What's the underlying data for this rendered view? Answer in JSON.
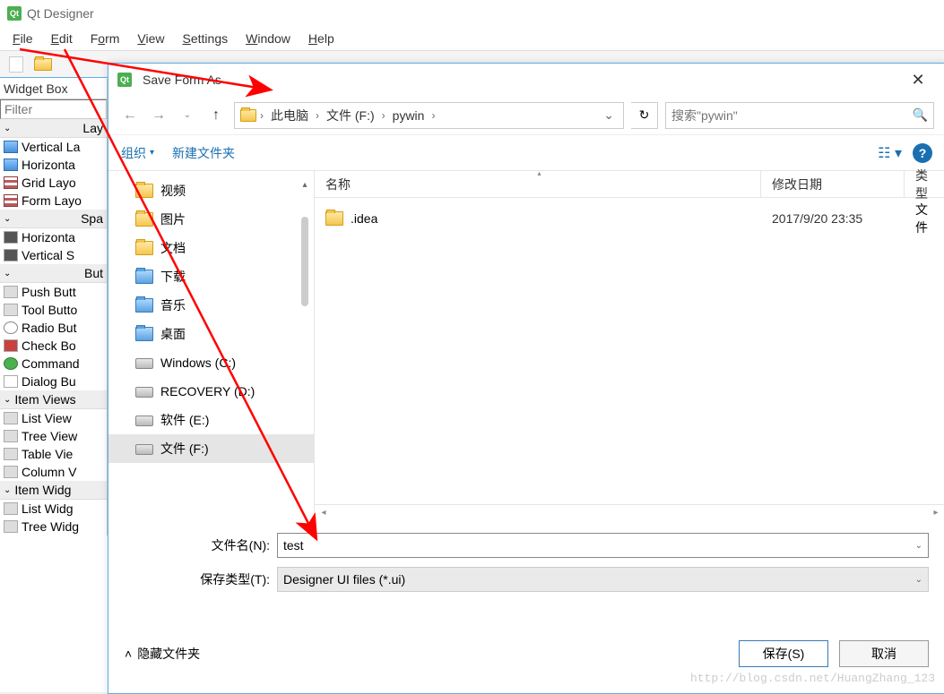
{
  "app": {
    "title": "Qt Designer"
  },
  "menu": {
    "file": "File",
    "edit": "Edit",
    "form": "Form",
    "view": "View",
    "settings": "Settings",
    "window": "Window",
    "help": "Help"
  },
  "widgetbox": {
    "title": "Widget Box",
    "filter_placeholder": "Filter",
    "cat_layouts": "Lay",
    "items_layouts": [
      "Vertical La",
      "Horizonta",
      "Grid Layo",
      "Form Layo"
    ],
    "cat_spacers": "Spa",
    "items_spacers": [
      "Horizonta",
      "Vertical S"
    ],
    "cat_buttons": "But",
    "items_buttons": [
      "Push Butt",
      "Tool Butto",
      "Radio But",
      "Check Bo",
      "Command",
      "Dialog Bu"
    ],
    "cat_itemviews": "Item Views",
    "items_itemviews": [
      "List View",
      "Tree View",
      "Table Vie",
      "Column V"
    ],
    "cat_itemwidg": "Item Widg",
    "items_itemwidg": [
      "List Widg",
      "Tree Widg"
    ]
  },
  "dialog": {
    "title": "Save Form As",
    "breadcrumb": {
      "pc": "此电脑",
      "drive": "文件 (F:)",
      "folder": "pywin"
    },
    "search_placeholder": "搜索\"pywin\"",
    "organize": "组织",
    "newfolder": "新建文件夹",
    "tree": {
      "video": "视频",
      "pictures": "图片",
      "documents": "文档",
      "downloads": "下载",
      "music": "音乐",
      "desktop": "桌面",
      "c": "Windows (C:)",
      "d": "RECOVERY (D:)",
      "e": "软件 (E:)",
      "f": "文件 (F:)"
    },
    "columns": {
      "name": "名称",
      "date": "修改日期",
      "type": "类型"
    },
    "files": [
      {
        "name": ".idea",
        "date": "2017/9/20 23:35",
        "type": "文件"
      }
    ],
    "filename_label": "文件名(N):",
    "filename_value": "test",
    "filetype_label": "保存类型(T):",
    "filetype_value": "Designer UI files (*.ui)",
    "hide_folders": "隐藏文件夹",
    "save": "保存(S)",
    "cancel": "取消"
  },
  "watermark": "http://blog.csdn.net/HuangZhang_123"
}
